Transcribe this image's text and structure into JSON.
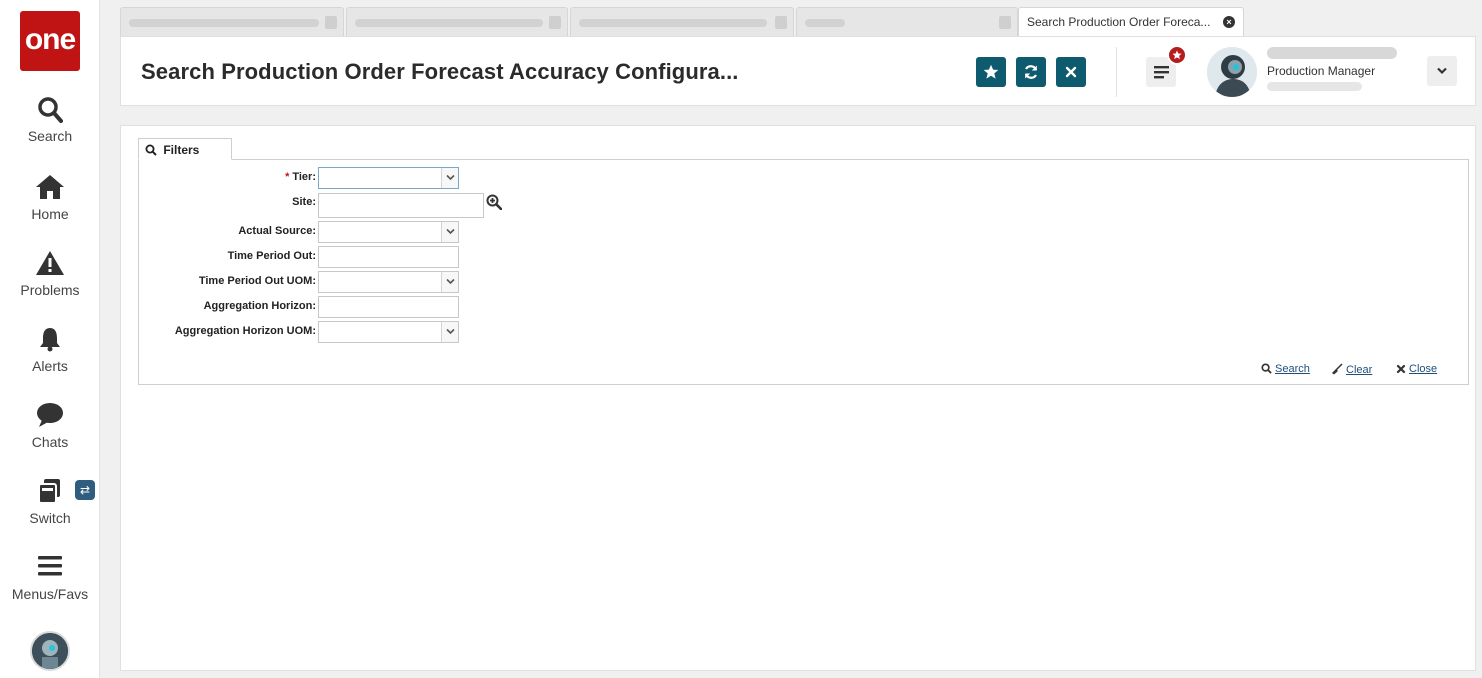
{
  "app": {
    "logo_text": "one",
    "brand_color": "#c01414",
    "accent_color": "#0e5a6e"
  },
  "nav": {
    "items": [
      {
        "label": "Search",
        "icon": "search-icon"
      },
      {
        "label": "Home",
        "icon": "home-icon"
      },
      {
        "label": "Problems",
        "icon": "warning-icon"
      },
      {
        "label": "Alerts",
        "icon": "bell-icon"
      },
      {
        "label": "Chats",
        "icon": "chat-bubble-icon"
      },
      {
        "label": "Switch",
        "icon": "switch-windows-icon"
      },
      {
        "label": "Menus/Favs",
        "icon": "hamburger-menu-icon"
      }
    ],
    "switch_badge": "⇄"
  },
  "tabs": [
    {
      "label": "",
      "active": false
    },
    {
      "label": "",
      "active": false
    },
    {
      "label": "",
      "active": false
    },
    {
      "label": "",
      "active": false
    },
    {
      "label": "Search Production Order Foreca...",
      "active": true
    }
  ],
  "header": {
    "title": "Search Production Order Forecast Accuracy Configura...",
    "buttons": [
      "star-icon",
      "refresh-icon",
      "close-icon"
    ],
    "user_role": "Production Manager"
  },
  "filters": {
    "tab_label": "Filters",
    "fields": [
      {
        "label": "Tier:",
        "required": true,
        "type": "select",
        "value": ""
      },
      {
        "label": "Site:",
        "required": false,
        "type": "lookup",
        "value": ""
      },
      {
        "label": "Actual Source:",
        "required": false,
        "type": "select",
        "value": ""
      },
      {
        "label": "Time Period Out:",
        "required": false,
        "type": "text",
        "value": ""
      },
      {
        "label": "Time Period Out UOM:",
        "required": false,
        "type": "select",
        "value": ""
      },
      {
        "label": "Aggregation Horizon:",
        "required": false,
        "type": "text",
        "value": ""
      },
      {
        "label": "Aggregation Horizon UOM:",
        "required": false,
        "type": "select",
        "value": ""
      }
    ],
    "required_mark": "*",
    "actions": {
      "search": "Search",
      "clear": "Clear",
      "close": "Close"
    }
  }
}
